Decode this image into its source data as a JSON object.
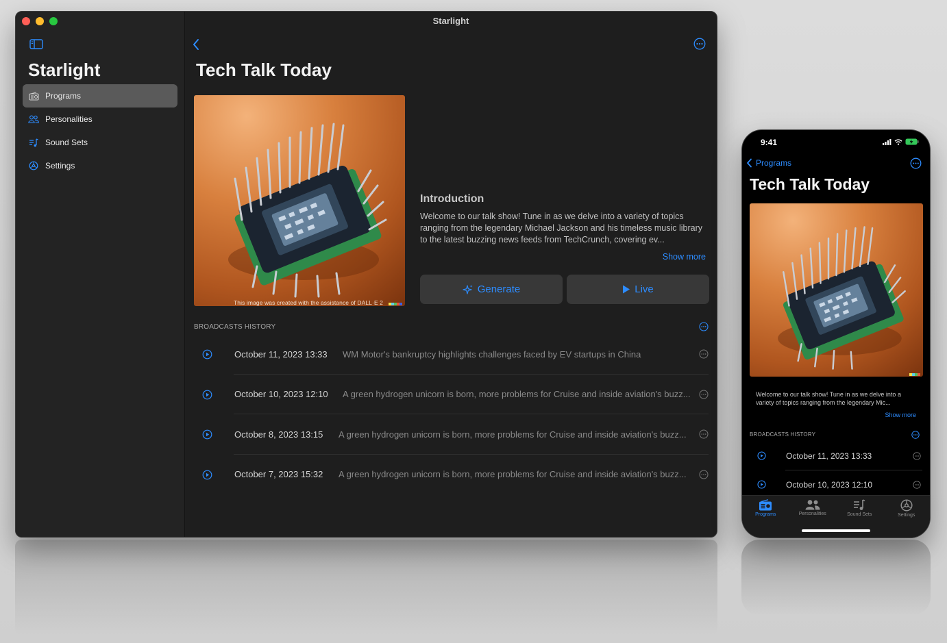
{
  "mac": {
    "window_title": "Starlight",
    "sidebar": {
      "title": "Starlight",
      "items": [
        {
          "label": "Programs",
          "icon": "radio-icon",
          "active": true
        },
        {
          "label": "Personalities",
          "icon": "people-icon",
          "active": false
        },
        {
          "label": "Sound Sets",
          "icon": "music-list-icon",
          "active": false
        },
        {
          "label": "Settings",
          "icon": "gear-icon",
          "active": false
        }
      ]
    },
    "main": {
      "title": "Tech Talk Today",
      "artwork_caption": "This image was created with the assistance of DALL·E 2",
      "intro_heading": "Introduction",
      "intro_text": "Welcome to our talk show! Tune in as we delve into a variety of topics ranging from the legendary Michael Jackson and his timeless music library to the latest buzzing news feeds from TechCrunch, covering ev...",
      "show_more": "Show more",
      "generate_label": "Generate",
      "live_label": "Live",
      "history_label": "BROADCASTS HISTORY",
      "broadcasts": [
        {
          "date": "October 11, 2023  13:33",
          "description": "WM Motor's bankruptcy highlights challenges faced by EV startups in China"
        },
        {
          "date": "October 10, 2023  12:10",
          "description": "A green hydrogen unicorn is born, more problems for Cruise and inside aviation's buzz..."
        },
        {
          "date": "October 8, 2023  13:15",
          "description": "A green hydrogen unicorn is born, more problems for Cruise and inside aviation's buzz..."
        },
        {
          "date": "October 7, 2023  15:32",
          "description": "A green hydrogen unicorn is born, more problems for Cruise and inside aviation's buzz..."
        }
      ]
    }
  },
  "phone": {
    "time": "9:41",
    "back_label": "Programs",
    "title": "Tech Talk Today",
    "intro_text": "Welcome to our talk show! Tune in as we delve into a variety of topics ranging from the legendary Mic...",
    "show_more": "Show more",
    "history_label": "BROADCASTS HISTORY",
    "broadcasts": [
      {
        "date": "October 11, 2023  13:33"
      },
      {
        "date": "October 10, 2023  12:10"
      }
    ],
    "tabs": [
      {
        "label": "Programs",
        "active": true
      },
      {
        "label": "Personalities",
        "active": false
      },
      {
        "label": "Sound Sets",
        "active": false
      },
      {
        "label": "Settings",
        "active": false
      }
    ]
  },
  "colors": {
    "accent": "#2d8cff",
    "window_bg": "#1e1e1e",
    "sidebar_bg": "#232323",
    "selected_bg": "#5a5a5a"
  }
}
